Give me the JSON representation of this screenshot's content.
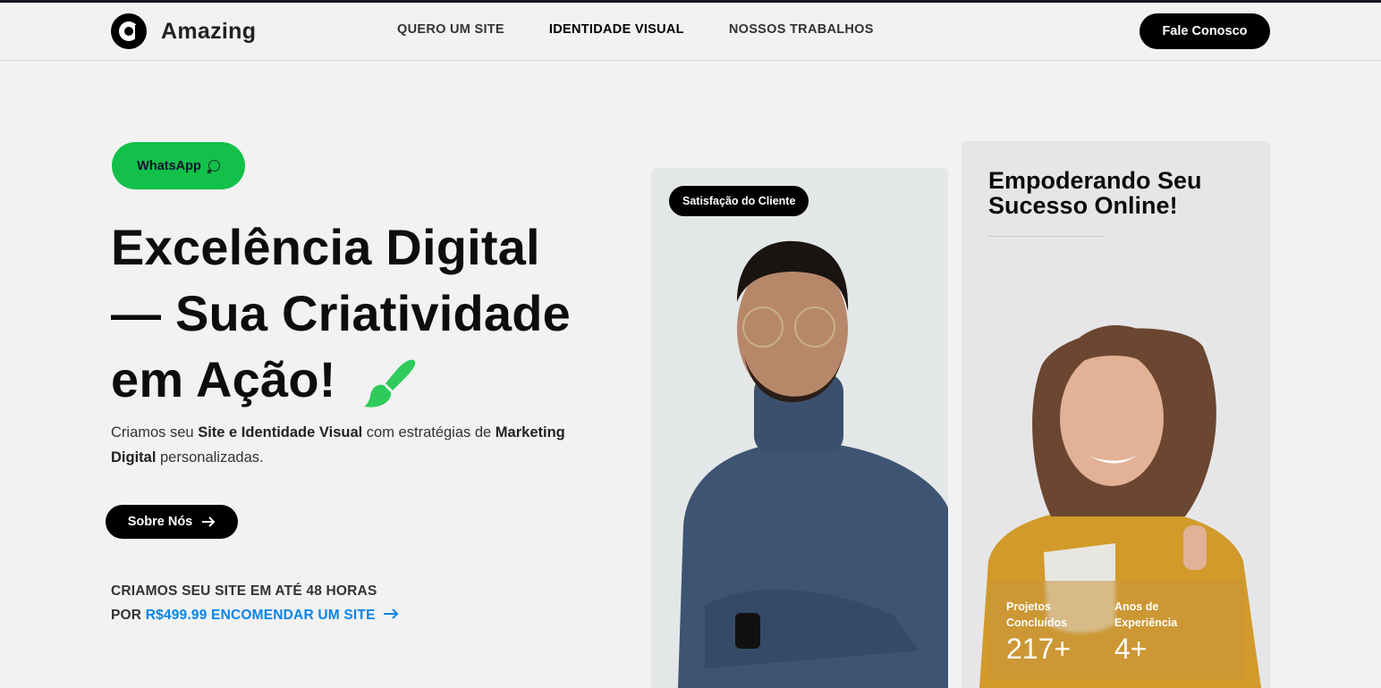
{
  "brand": {
    "name": "Amazing"
  },
  "nav": {
    "items": [
      {
        "label": "QUERO UM SITE"
      },
      {
        "label": "IDENTIDADE VISUAL"
      },
      {
        "label": "NOSSOS TRABALHOS"
      }
    ],
    "cta_label": "Fale Conosco"
  },
  "hero": {
    "whatsapp_label": "WhatsApp",
    "title_line1": "Excelência Digital",
    "title_line2": "— Sua Criatividade",
    "title_line3": "em Ação!",
    "desc_part1": "Criamos seu ",
    "desc_bold1": "Site e Identidade Visual",
    "desc_part2": " com estratégias de ",
    "desc_bold2": "Marketing Digital",
    "desc_part3": " personalizadas.",
    "about_label": "Sobre Nós",
    "promo_line1": "CRIAMOS SEU SITE EM ATÉ 48 HORAS",
    "promo_prefix": "POR ",
    "promo_link": "R$499.99 ENCOMENDAR UM SITE"
  },
  "card_left": {
    "badge": "Satisfação do Cliente"
  },
  "card_right": {
    "title": "Empoderando Seu Sucesso Online!",
    "stats": [
      {
        "label": "Projetos Concluídos",
        "value": "217+"
      },
      {
        "label": "Anos de Experiência",
        "value": "4+"
      }
    ]
  },
  "colors": {
    "accent_green": "#13c04a",
    "link_blue": "#0a84e8",
    "dark": "#000000"
  },
  "icons": [
    "logo-icon",
    "whatsapp-icon",
    "paintbrush-icon",
    "arrow-right-icon"
  ]
}
